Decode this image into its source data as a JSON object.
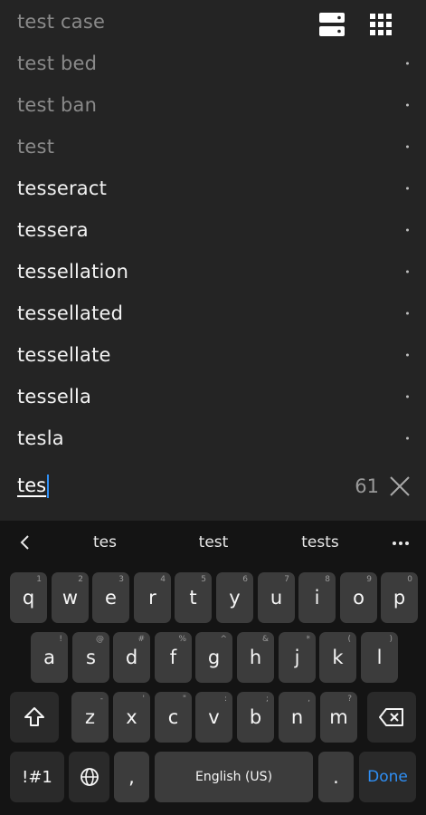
{
  "word_list": [
    {
      "word": "test case",
      "faded": true
    },
    {
      "word": "test bed",
      "faded": true
    },
    {
      "word": "test ban",
      "faded": true
    },
    {
      "word": "test",
      "faded": true
    },
    {
      "word": "tesseract",
      "faded": false
    },
    {
      "word": "tessera",
      "faded": false
    },
    {
      "word": "tessellation",
      "faded": false
    },
    {
      "word": "tessellated",
      "faded": false
    },
    {
      "word": "tessellate",
      "faded": false
    },
    {
      "word": "tessella",
      "faded": false
    },
    {
      "word": "tesla",
      "faded": false
    }
  ],
  "toolbar": {
    "list_view_icon": "list-view-icon",
    "grid_view_icon": "grid-view-icon"
  },
  "search": {
    "query": "tes",
    "result_count": "61",
    "clear_icon": "close-icon"
  },
  "suggestions": {
    "items": [
      "tes",
      "test",
      "tests"
    ],
    "back_icon": "chevron-left-icon",
    "more_icon": "more-icon"
  },
  "keyboard": {
    "row1": [
      {
        "key": "q",
        "hint": "1"
      },
      {
        "key": "w",
        "hint": "2"
      },
      {
        "key": "e",
        "hint": "3"
      },
      {
        "key": "r",
        "hint": "4"
      },
      {
        "key": "t",
        "hint": "5"
      },
      {
        "key": "y",
        "hint": "6"
      },
      {
        "key": "u",
        "hint": "7"
      },
      {
        "key": "i",
        "hint": "8"
      },
      {
        "key": "o",
        "hint": "9"
      },
      {
        "key": "p",
        "hint": "0"
      }
    ],
    "row2": [
      {
        "key": "a",
        "hint": "!"
      },
      {
        "key": "s",
        "hint": "@"
      },
      {
        "key": "d",
        "hint": "#"
      },
      {
        "key": "f",
        "hint": "%"
      },
      {
        "key": "g",
        "hint": "^"
      },
      {
        "key": "h",
        "hint": "&"
      },
      {
        "key": "j",
        "hint": "*"
      },
      {
        "key": "k",
        "hint": "("
      },
      {
        "key": "l",
        "hint": ")"
      }
    ],
    "row3": [
      {
        "key": "z",
        "hint": "-"
      },
      {
        "key": "x",
        "hint": "'"
      },
      {
        "key": "c",
        "hint": "\""
      },
      {
        "key": "v",
        "hint": ":"
      },
      {
        "key": "b",
        "hint": ";"
      },
      {
        "key": "n",
        "hint": ","
      },
      {
        "key": "m",
        "hint": "?"
      }
    ],
    "shift_icon": "shift-icon",
    "backspace_icon": "backspace-icon",
    "symbols_label": "!#1",
    "globe_icon": "globe-icon",
    "comma_label": ",",
    "space_label": "English (US)",
    "period_label": ".",
    "done_label": "Done",
    "accent_color": "#2f8ff5"
  }
}
